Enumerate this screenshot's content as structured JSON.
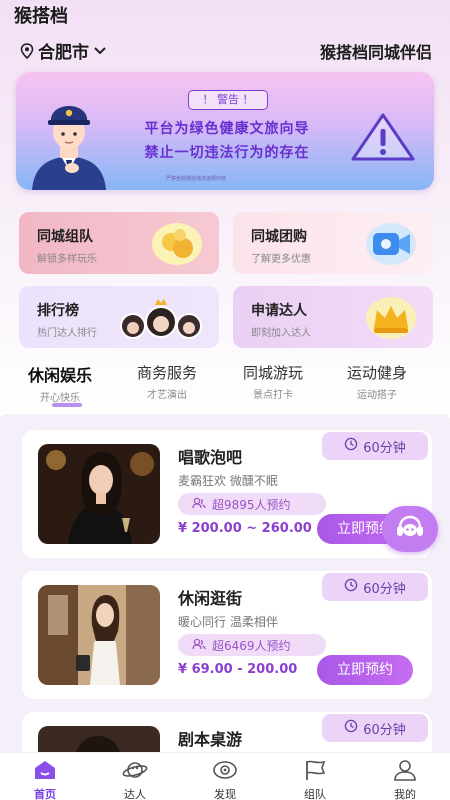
{
  "app": {
    "title": "猴搭档"
  },
  "header": {
    "city": "合肥市",
    "slogan": "猴搭档同城伴侣"
  },
  "banner": {
    "warning": "！ 警告 ！",
    "line1": "平台为绿色健康文旅向导",
    "line2": "禁止一切违法行为的存在",
    "small_text": "严禁色情低俗违法违规内容"
  },
  "features": [
    {
      "title": "同城组队",
      "subtitle": "解锁多样玩乐"
    },
    {
      "title": "同城团购",
      "subtitle": "了解更多优惠"
    },
    {
      "title": "排行榜",
      "subtitle": "热门达人排行"
    },
    {
      "title": "申请达人",
      "subtitle": "即刻加入达人"
    }
  ],
  "categories": [
    {
      "title": "休闲娱乐",
      "subtitle": "开心快乐"
    },
    {
      "title": "商务服务",
      "subtitle": "才艺演出"
    },
    {
      "title": "同城游玩",
      "subtitle": "景点打卡"
    },
    {
      "title": "运动健身",
      "subtitle": "运动搭子"
    }
  ],
  "cards": [
    {
      "title": "唱歌泡吧",
      "subtitle": "麦霸狂欢 微醺不眠",
      "booked": "超9895人预约",
      "price": "¥ 200.00 ~ 260.00",
      "duration": "60分钟",
      "button": "立即预约"
    },
    {
      "title": "休闲逛街",
      "subtitle": "暖心同行 温柔相伴",
      "booked": "超6469人预约",
      "price": "¥ 69.00 - 200.00",
      "duration": "60分钟",
      "button": "立即预约"
    },
    {
      "title": "剧本桌游",
      "duration": "60分钟"
    }
  ],
  "nav": [
    {
      "label": "首页",
      "icon": "home-icon"
    },
    {
      "label": "达人",
      "icon": "planet-icon"
    },
    {
      "label": "发现",
      "icon": "eye-icon"
    },
    {
      "label": "组队",
      "icon": "flag-icon"
    },
    {
      "label": "我的",
      "icon": "user-icon"
    }
  ],
  "colors": {
    "accent": "#a957e8",
    "price": "#8a3fd0",
    "nav_active": "#7a3fe0"
  }
}
